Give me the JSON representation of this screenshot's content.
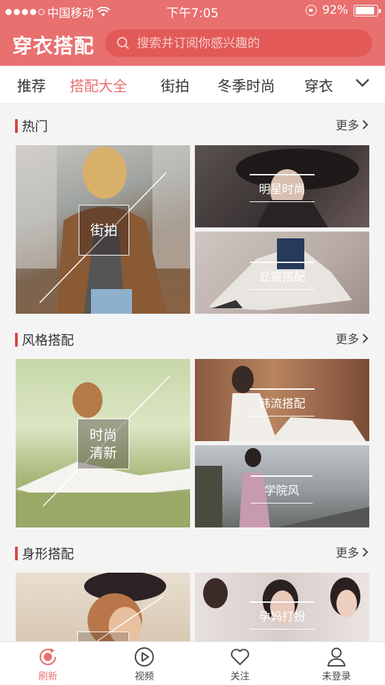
{
  "status_bar": {
    "carrier": "中国移动",
    "time": "下午7:05",
    "battery": "92%",
    "battery_level": 0.92
  },
  "header": {
    "brand": "穿衣搭配",
    "search_placeholder": "搜索并订阅你感兴趣的",
    "colors": {
      "accent": "#e8706f",
      "search_bg": "#e25957"
    }
  },
  "tabs": {
    "items": [
      "推荐",
      "搭配大全",
      "街拍",
      "冬季时尚",
      "穿衣"
    ],
    "active_index": 1,
    "expand_icon": "chevron-down-icon"
  },
  "sections": [
    {
      "title": "热门",
      "more": "更多",
      "large_label": "街拍",
      "small_labels": [
        "明星时尚",
        "显瘦搭配"
      ]
    },
    {
      "title": "风格搭配",
      "more": "更多",
      "large_label": "时尚\n清新",
      "small_labels": [
        "韩流搭配",
        "学院风"
      ]
    },
    {
      "title": "身形搭配",
      "more": "更多",
      "large_label": "",
      "small_labels": [
        "孕妈打扮"
      ]
    }
  ],
  "bottom_nav": {
    "items": [
      {
        "label": "刷新",
        "icon": "refresh-icon"
      },
      {
        "label": "视频",
        "icon": "play-icon"
      },
      {
        "label": "关注",
        "icon": "heart-icon"
      },
      {
        "label": "未登录",
        "icon": "user-icon"
      }
    ],
    "active_index": 0
  }
}
